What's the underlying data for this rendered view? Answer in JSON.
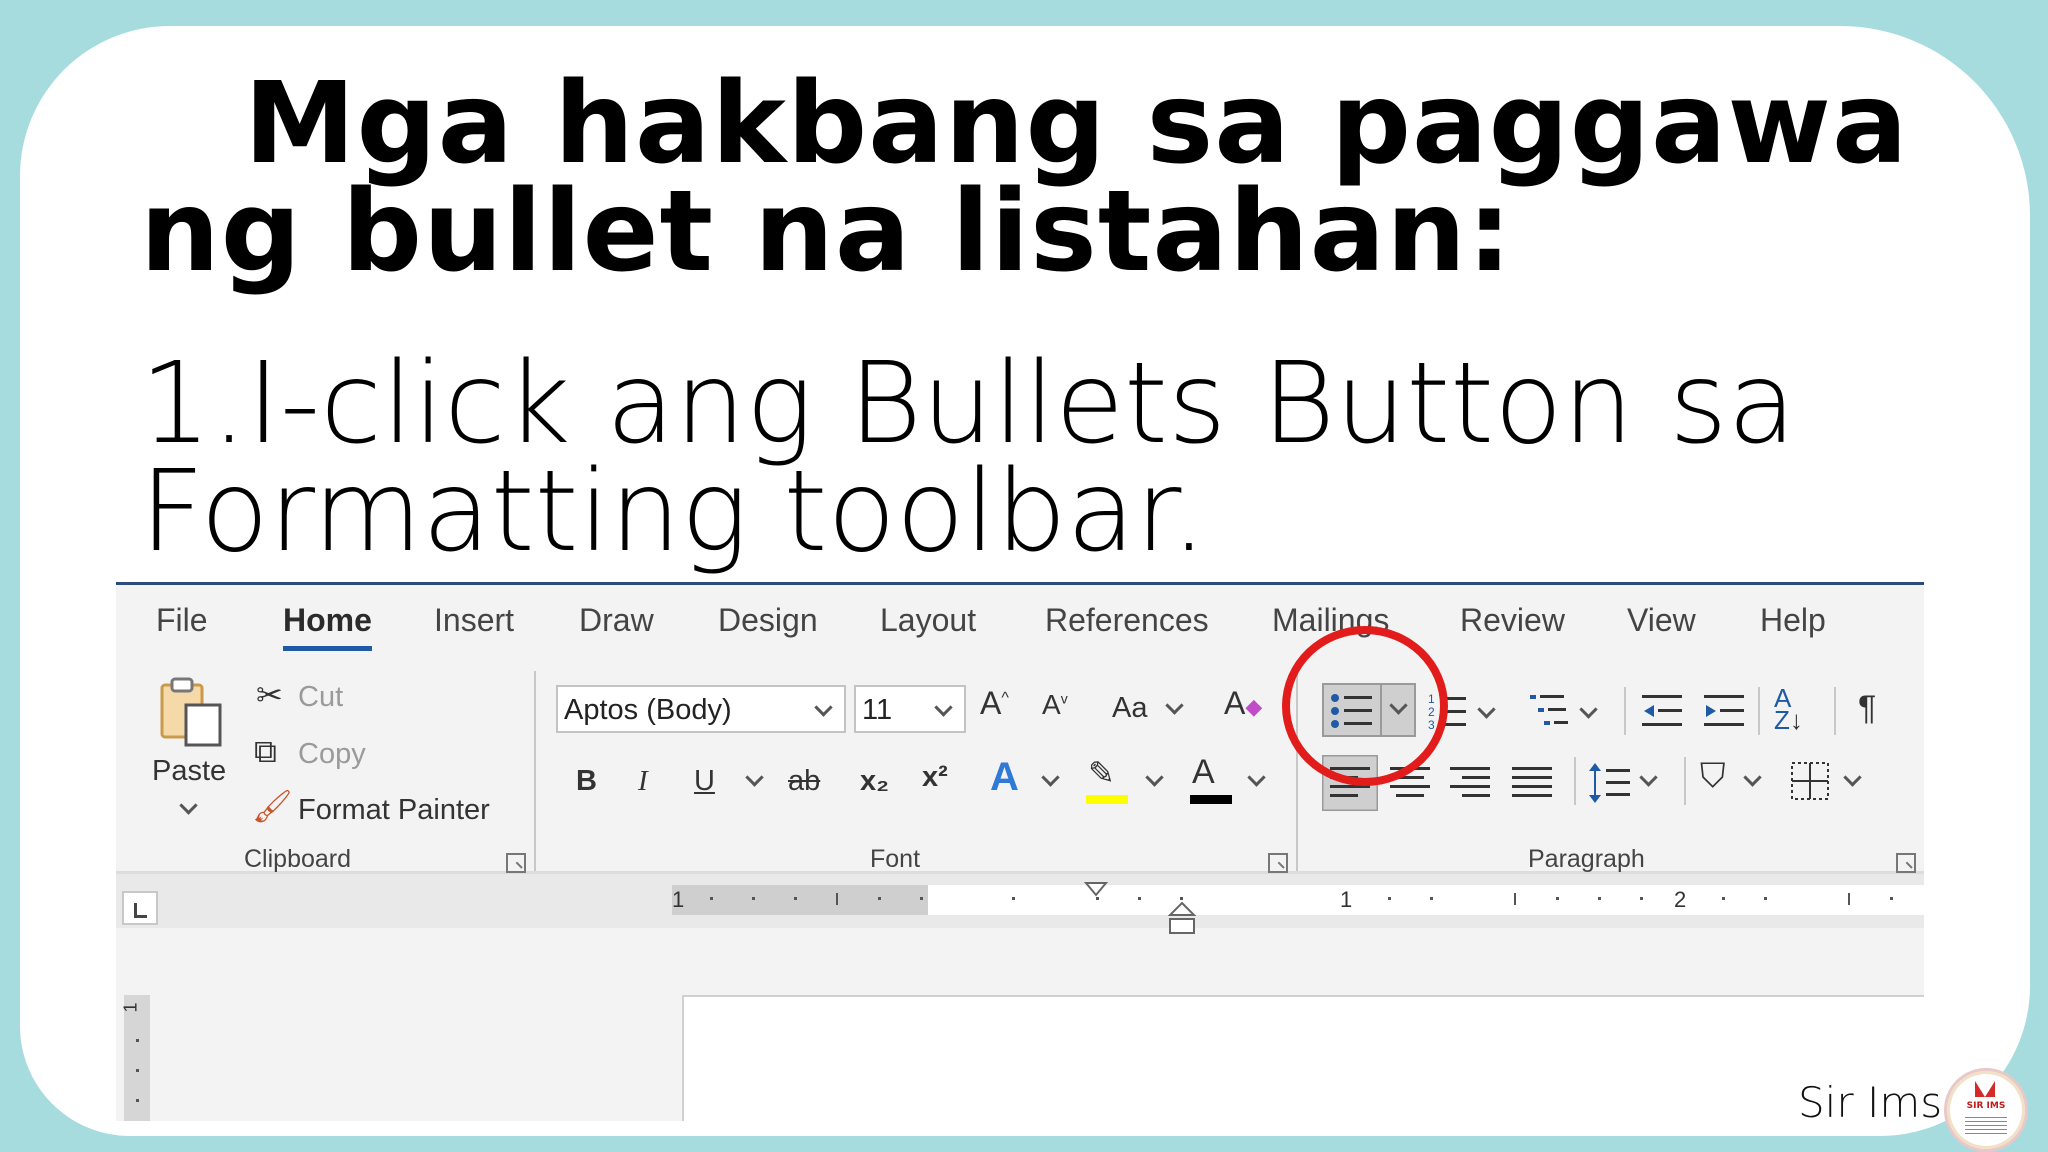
{
  "slide": {
    "title_line1": "Mga hakbang sa paggawa",
    "title_line2": "ng bullet na listahan:",
    "step_line1": "1.I-click ang Bullets Button sa",
    "step_line2": "Formatting toolbar."
  },
  "word": {
    "tabs": [
      "File",
      "Home",
      "Insert",
      "Draw",
      "Design",
      "Layout",
      "References",
      "Mailings",
      "Review",
      "View",
      "Help"
    ],
    "active_tab": "Home",
    "clipboard": {
      "paste": "Paste",
      "cut": "Cut",
      "copy": "Copy",
      "format_painter": "Format Painter",
      "label": "Clipboard"
    },
    "font": {
      "family": "Aptos (Body)",
      "size": "11",
      "change_case": "Aa",
      "bold": "B",
      "italic": "I",
      "underline": "U",
      "strike": "ab",
      "subscript": "x₂",
      "superscript": "x²",
      "label": "Font"
    },
    "paragraph": {
      "label": "Paragraph"
    },
    "ruler": {
      "numbers": [
        "1",
        "1",
        "2"
      ]
    },
    "vertical_ruler_number": "1"
  },
  "colors": {
    "background": "#a7dcdf",
    "highlight_circle": "#e21b1b",
    "tab_underline": "#1f5aa6",
    "highlighter": "#ffff00",
    "font_color": "#000000"
  },
  "footer": {
    "signature": "Sir Ims",
    "logo_text": "SIR IMS"
  }
}
